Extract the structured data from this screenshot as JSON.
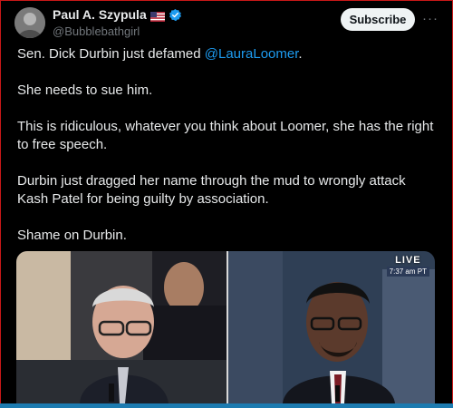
{
  "author": {
    "name": "Paul A. Szypula",
    "handle": "@Bubblebathgirl",
    "flag_icon": "us-flag-icon",
    "verified_icon": "verified-badge-icon",
    "verified_color": "#1d9bf0"
  },
  "actions": {
    "subscribe_label": "Subscribe",
    "more_label": "···"
  },
  "tweet": {
    "line1_pre": "Sen. Dick Durbin just defamed ",
    "line1_mention": "@LauraLoomer",
    "line1_post": ".",
    "para2": "She needs to sue him.",
    "para3": "This is ridiculous, whatever you think about Loomer, she has the right to free speech.",
    "para4": "Durbin just dragged her name through the mud to wrongly attack Kash Patel for being guilty by association.",
    "para5": "Shame on Durbin."
  },
  "media": {
    "live_label": "LIVE",
    "time_label": "7:37 am PT"
  },
  "colors": {
    "background": "#000000",
    "text": "#e7e9ea",
    "muted": "#71767b",
    "link": "#1d9bf0"
  }
}
